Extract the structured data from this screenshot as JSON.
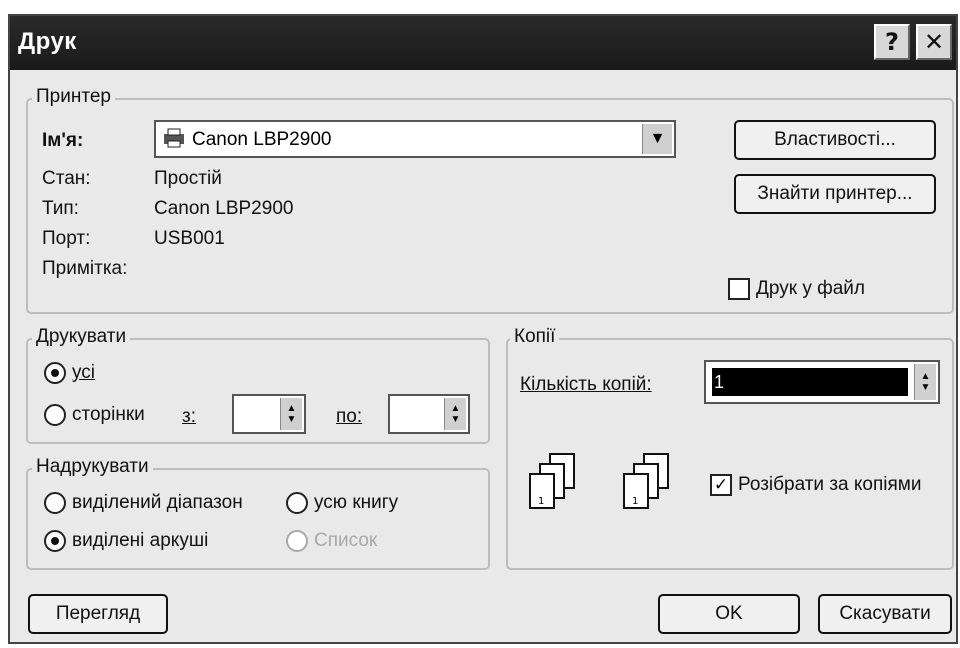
{
  "window": {
    "title": "Друк",
    "help_glyph": "?",
    "close_glyph": "✕"
  },
  "printer": {
    "legend": "Принтер",
    "name_label": "Ім'я:",
    "name_value": "Canon LBP2900",
    "status_label": "Стан:",
    "status_value": "Простій",
    "type_label": "Тип:",
    "type_value": "Canon LBP2900",
    "port_label": "Порт:",
    "port_value": "USB001",
    "note_label": "Примітка:",
    "properties_button": "Властивості...",
    "find_button": "Знайти принтер...",
    "print_to_file_label": "Друк у файл"
  },
  "print_range": {
    "legend": "Друкувати",
    "all_label": "усі",
    "pages_label": "сторінки",
    "from_label": "з:",
    "to_label": "по:",
    "from_value": "",
    "to_value": ""
  },
  "print_what": {
    "legend": "Надрукувати",
    "selection_label": "виділений діапазон",
    "workbook_label": "усю книгу",
    "sheets_label": "виділені аркуші",
    "list_label": "Список"
  },
  "copies": {
    "legend": "Копії",
    "count_label": "Кількість копій:",
    "count_value": "1",
    "collate_label": "Розібрати за копіями"
  },
  "footer": {
    "preview_button": "Перегляд",
    "ok_button": "OK",
    "cancel_button": "Скасувати"
  }
}
